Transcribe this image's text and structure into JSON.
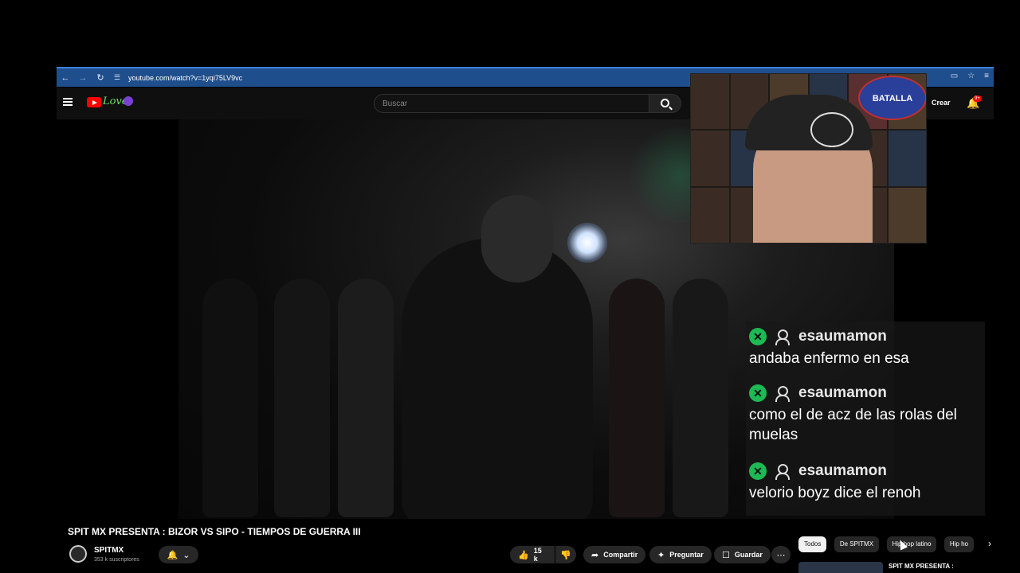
{
  "browser": {
    "url": "youtube.com/watch?v=1yqi75LV9vc",
    "back_icon": "back-arrow-icon",
    "forward_icon": "forward-arrow-icon",
    "reload_icon": "reload-icon"
  },
  "header": {
    "search_placeholder": "Buscar",
    "create_label": "Crear",
    "notification_badge": "9+"
  },
  "webcam": {
    "sign_text": "BATALLA"
  },
  "chat": {
    "messages": [
      {
        "user": "esaumamon",
        "text": "andaba enfermo en esa"
      },
      {
        "user": "esaumamon",
        "text": "como el de acz de las rolas del muelas"
      },
      {
        "user": "esaumamon",
        "text": "velorio boyz dice el renoh"
      }
    ]
  },
  "video": {
    "title": "SPIT MX PRESENTA : BIZOR VS SIPO - TIEMPOS DE GUERRA III",
    "channel_name": "SPITMX",
    "subscribers": "353 k suscriptores",
    "likes": "15 k",
    "share_label": "Compartir",
    "ask_label": "Preguntar",
    "save_label": "Guardar"
  },
  "chips": [
    "Todos",
    "De SPITMX",
    "Hip hop latino",
    "Hip ho"
  ],
  "recommendation": {
    "title": "SPIT MX PRESENTA :"
  },
  "colors": {
    "browser_bar": "#1f4e8c",
    "page_bg": "#0f0f0f",
    "yt_red": "#ff0000",
    "chat_badge": "#1db954"
  }
}
